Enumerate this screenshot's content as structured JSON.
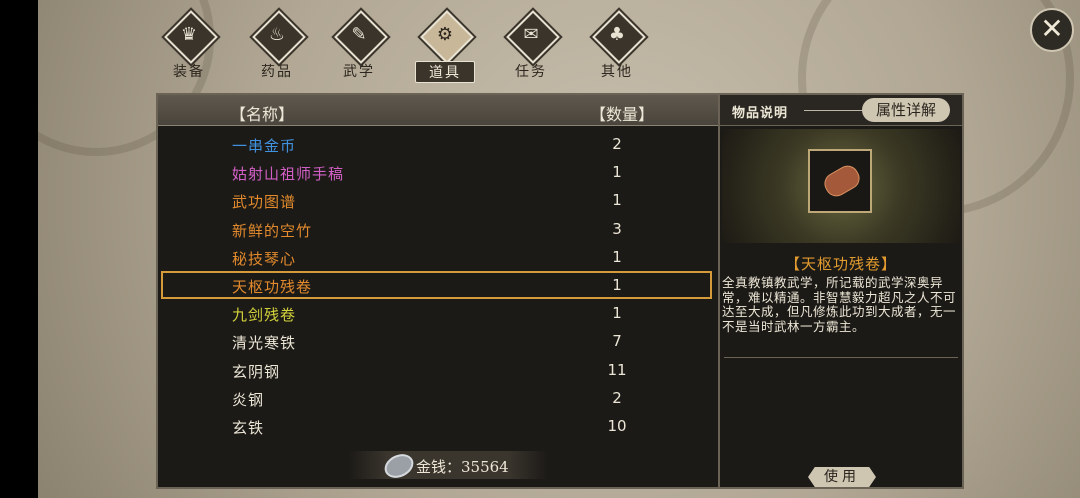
{
  "tabs": [
    {
      "label": "装备",
      "icon": "armor-icon",
      "glyph": "♛",
      "active": false
    },
    {
      "label": "药品",
      "icon": "potion-icon",
      "glyph": "♨",
      "active": false
    },
    {
      "label": "武学",
      "icon": "scroll-book-icon",
      "glyph": "✎",
      "active": false
    },
    {
      "label": "道具",
      "icon": "item-icon",
      "glyph": "⚙",
      "active": true
    },
    {
      "label": "任务",
      "icon": "quest-icon",
      "glyph": "✉",
      "active": false
    },
    {
      "label": "其他",
      "icon": "other-icon",
      "glyph": "♣",
      "active": false
    }
  ],
  "close_glyph": "✕",
  "list": {
    "header_name": "【名称】",
    "header_qty": "【数量】",
    "items": [
      {
        "name": "一串金币",
        "qty": "2",
        "color": "#3f92e0"
      },
      {
        "name": "姑射山祖师手稿",
        "qty": "1",
        "color": "#d15fc5"
      },
      {
        "name": "武功图谱",
        "qty": "1",
        "color": "#e28a2c"
      },
      {
        "name": "新鲜的空竹",
        "qty": "3",
        "color": "#e28a2c"
      },
      {
        "name": "秘技琴心",
        "qty": "1",
        "color": "#e28a2c"
      },
      {
        "name": "天枢功残卷",
        "qty": "1",
        "color": "#e28a2c"
      },
      {
        "name": "九剑残卷",
        "qty": "1",
        "color": "#d2d23a"
      },
      {
        "name": "清光寒铁",
        "qty": "7",
        "color": "#ece6d6"
      },
      {
        "name": "玄阴钢",
        "qty": "11",
        "color": "#ece6d6"
      },
      {
        "name": "炎钢",
        "qty": "2",
        "color": "#ece6d6"
      },
      {
        "name": "玄铁",
        "qty": "10",
        "color": "#ece6d6"
      }
    ],
    "money_label": "金钱：35564"
  },
  "detail": {
    "title": "物品说明",
    "attr_button": "属性详解",
    "item_title": "【天枢功残卷】",
    "description": "全真教镇教武学，所记载的武学深奥异常，难以精通。非智慧毅力超凡之人不可达至大成，但凡修炼此功到大成者，无一不是当时武林一方霸主。",
    "use_button": "使用"
  }
}
